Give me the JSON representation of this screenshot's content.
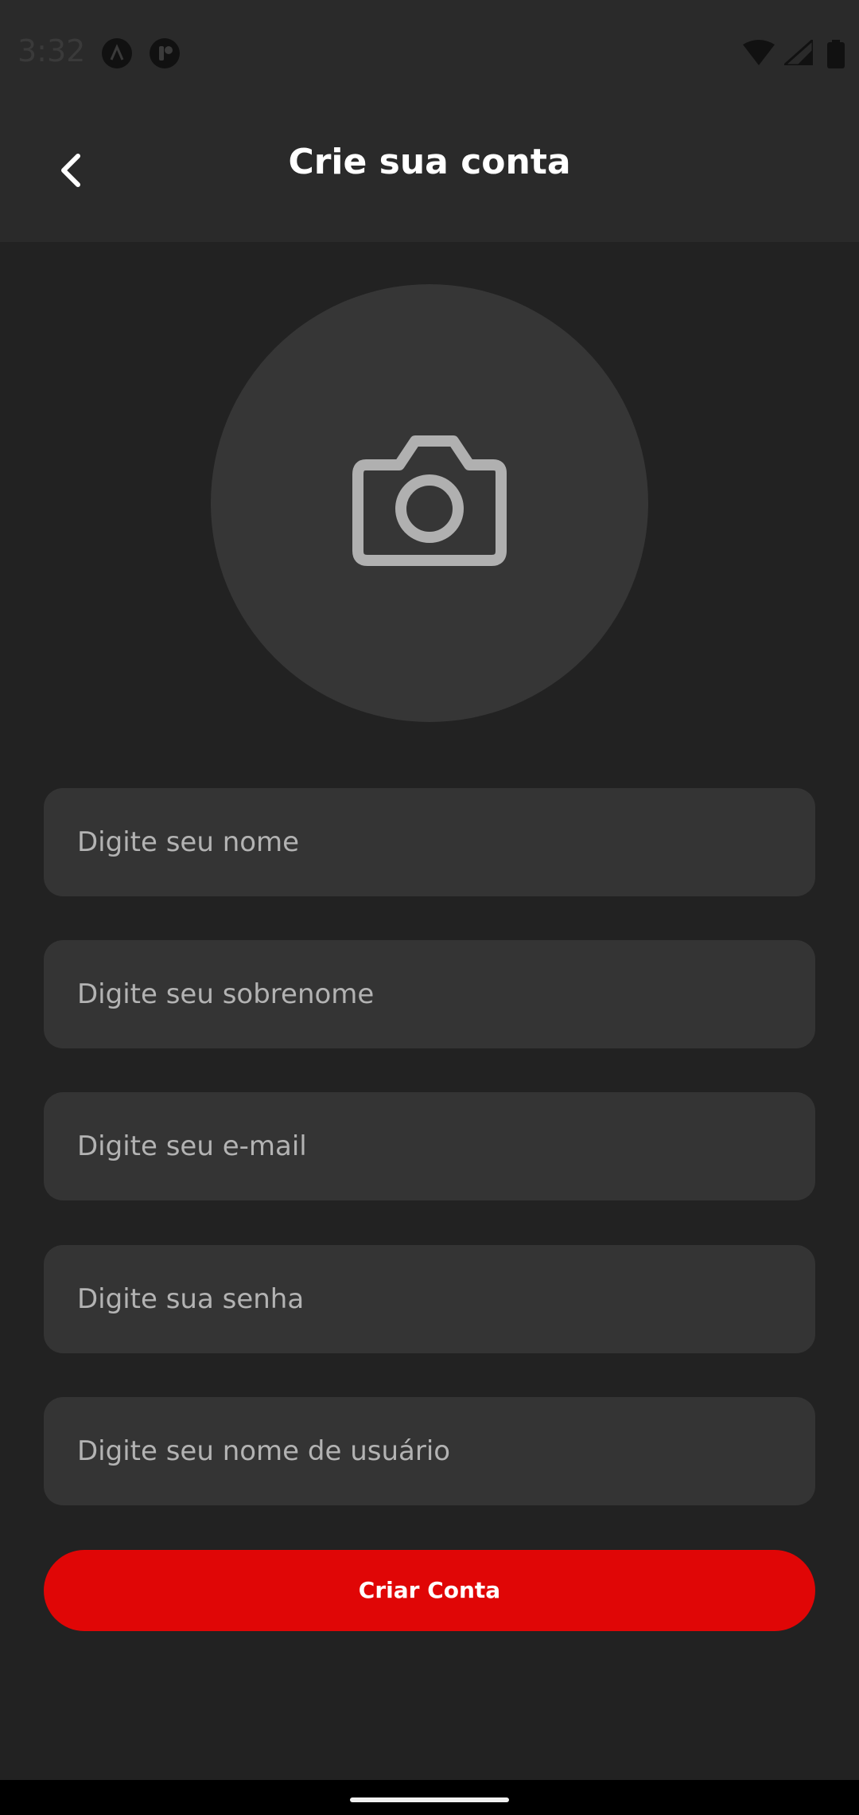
{
  "status_bar": {
    "time": "3:32",
    "icons": [
      "app-a-icon",
      "app-b-icon",
      "wifi-icon",
      "cellular-signal-icon",
      "battery-icon"
    ]
  },
  "header": {
    "title": "Crie sua conta",
    "back_icon": "chevron-left-icon"
  },
  "avatar": {
    "icon": "camera-icon"
  },
  "form": {
    "first_name_placeholder": "Digite seu nome",
    "last_name_placeholder": "Digite seu sobrenome",
    "email_placeholder": "Digite seu e-mail",
    "password_placeholder": "Digite sua senha",
    "username_placeholder": "Digite seu nome de usuário",
    "submit_label": "Criar Conta"
  },
  "colors": {
    "background": "#222222",
    "header": "#2a2a2a",
    "input": "#343434",
    "accent": "#e00606",
    "text": "#ffffff",
    "placeholder": "#b3b3b3"
  }
}
